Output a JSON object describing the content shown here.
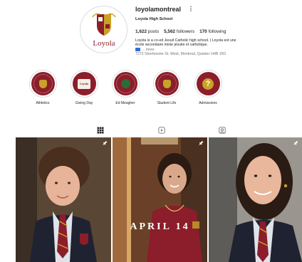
{
  "profile": {
    "username": "loyolamontreal",
    "more_menu_icon": "more-dots-icon",
    "full_name": "Loyola High School",
    "logo_text": "Loyola",
    "stats": {
      "posts_count": "1,622",
      "posts_label": "posts",
      "followers_count": "5,562",
      "followers_label": "followers",
      "following_count": "170",
      "following_label": "following"
    },
    "bio": {
      "line1": "Loyola is a co-ed Jesuit Catholic high school. | Loyola est une",
      "line2": "école secondaire mixte jésuite et catholique.",
      "more": "... more",
      "address": "7272 Sherbrooke St. West, Montreal, Quebec H4B 1R2"
    }
  },
  "highlights": [
    {
      "label": "Athletics",
      "icon": "athletics-highlight"
    },
    {
      "label": "Giving Day",
      "icon": "giving-day-highlight",
      "badge_text": "Loyola"
    },
    {
      "label": "Ed Meagher",
      "icon": "ed-meagher-highlight"
    },
    {
      "label": "Student Life",
      "icon": "student-life-highlight"
    },
    {
      "label": "Admissions",
      "icon": "question-mark-highlight",
      "badge_text": "?"
    }
  ],
  "tabs": [
    {
      "name": "posts",
      "icon": "grid-icon",
      "active": true
    },
    {
      "name": "reels",
      "icon": "reels-icon",
      "active": false
    },
    {
      "name": "tagged",
      "icon": "tagged-icon",
      "active": false
    }
  ],
  "posts": [
    {
      "pinned": true,
      "overlay_text": ""
    },
    {
      "pinned": true,
      "overlay_text": "APRIL 14"
    },
    {
      "pinned": true,
      "overlay_text": ""
    }
  ],
  "colors": {
    "brand_maroon": "#8c1d2a",
    "brand_gold": "#c9a227",
    "link_blue": "#2f6fd6"
  }
}
